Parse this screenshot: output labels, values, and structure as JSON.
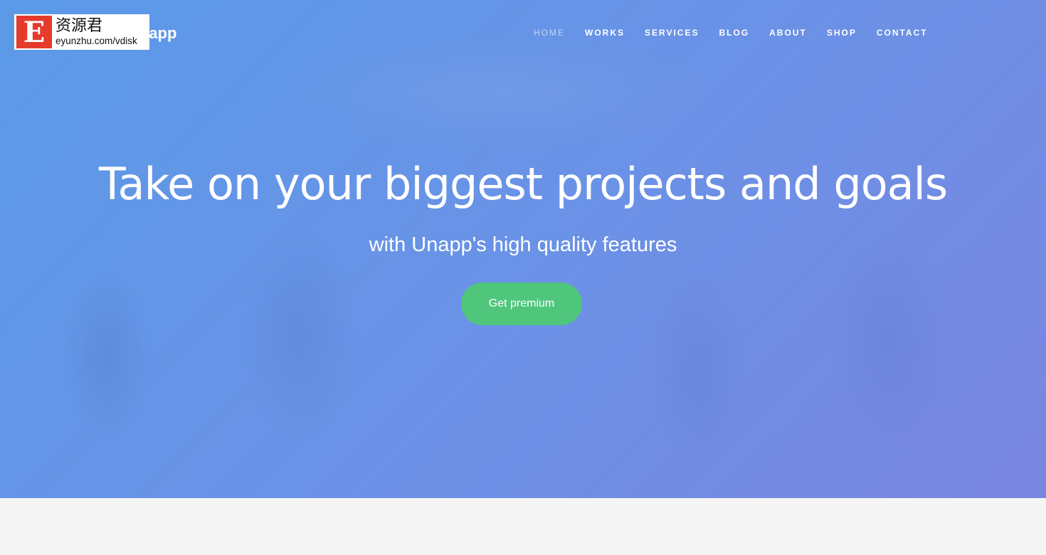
{
  "header": {
    "brand": "Unapp",
    "nav": [
      {
        "label": "HOME",
        "active": true
      },
      {
        "label": "WORKS"
      },
      {
        "label": "SERVICES"
      },
      {
        "label": "BLOG"
      },
      {
        "label": "ABOUT"
      },
      {
        "label": "SHOP"
      },
      {
        "label": "CONTACT"
      }
    ]
  },
  "watermark": {
    "letter": "E",
    "chinese": "资源君",
    "url": "eyunzhu.com/vdisk"
  },
  "hero": {
    "title": "Take on your biggest projects and goals",
    "subtitle": "with Unapp's high quality features",
    "cta": "Get premium",
    "colors": {
      "overlay": "#6a92e6",
      "cta": "#4fc67c"
    }
  }
}
